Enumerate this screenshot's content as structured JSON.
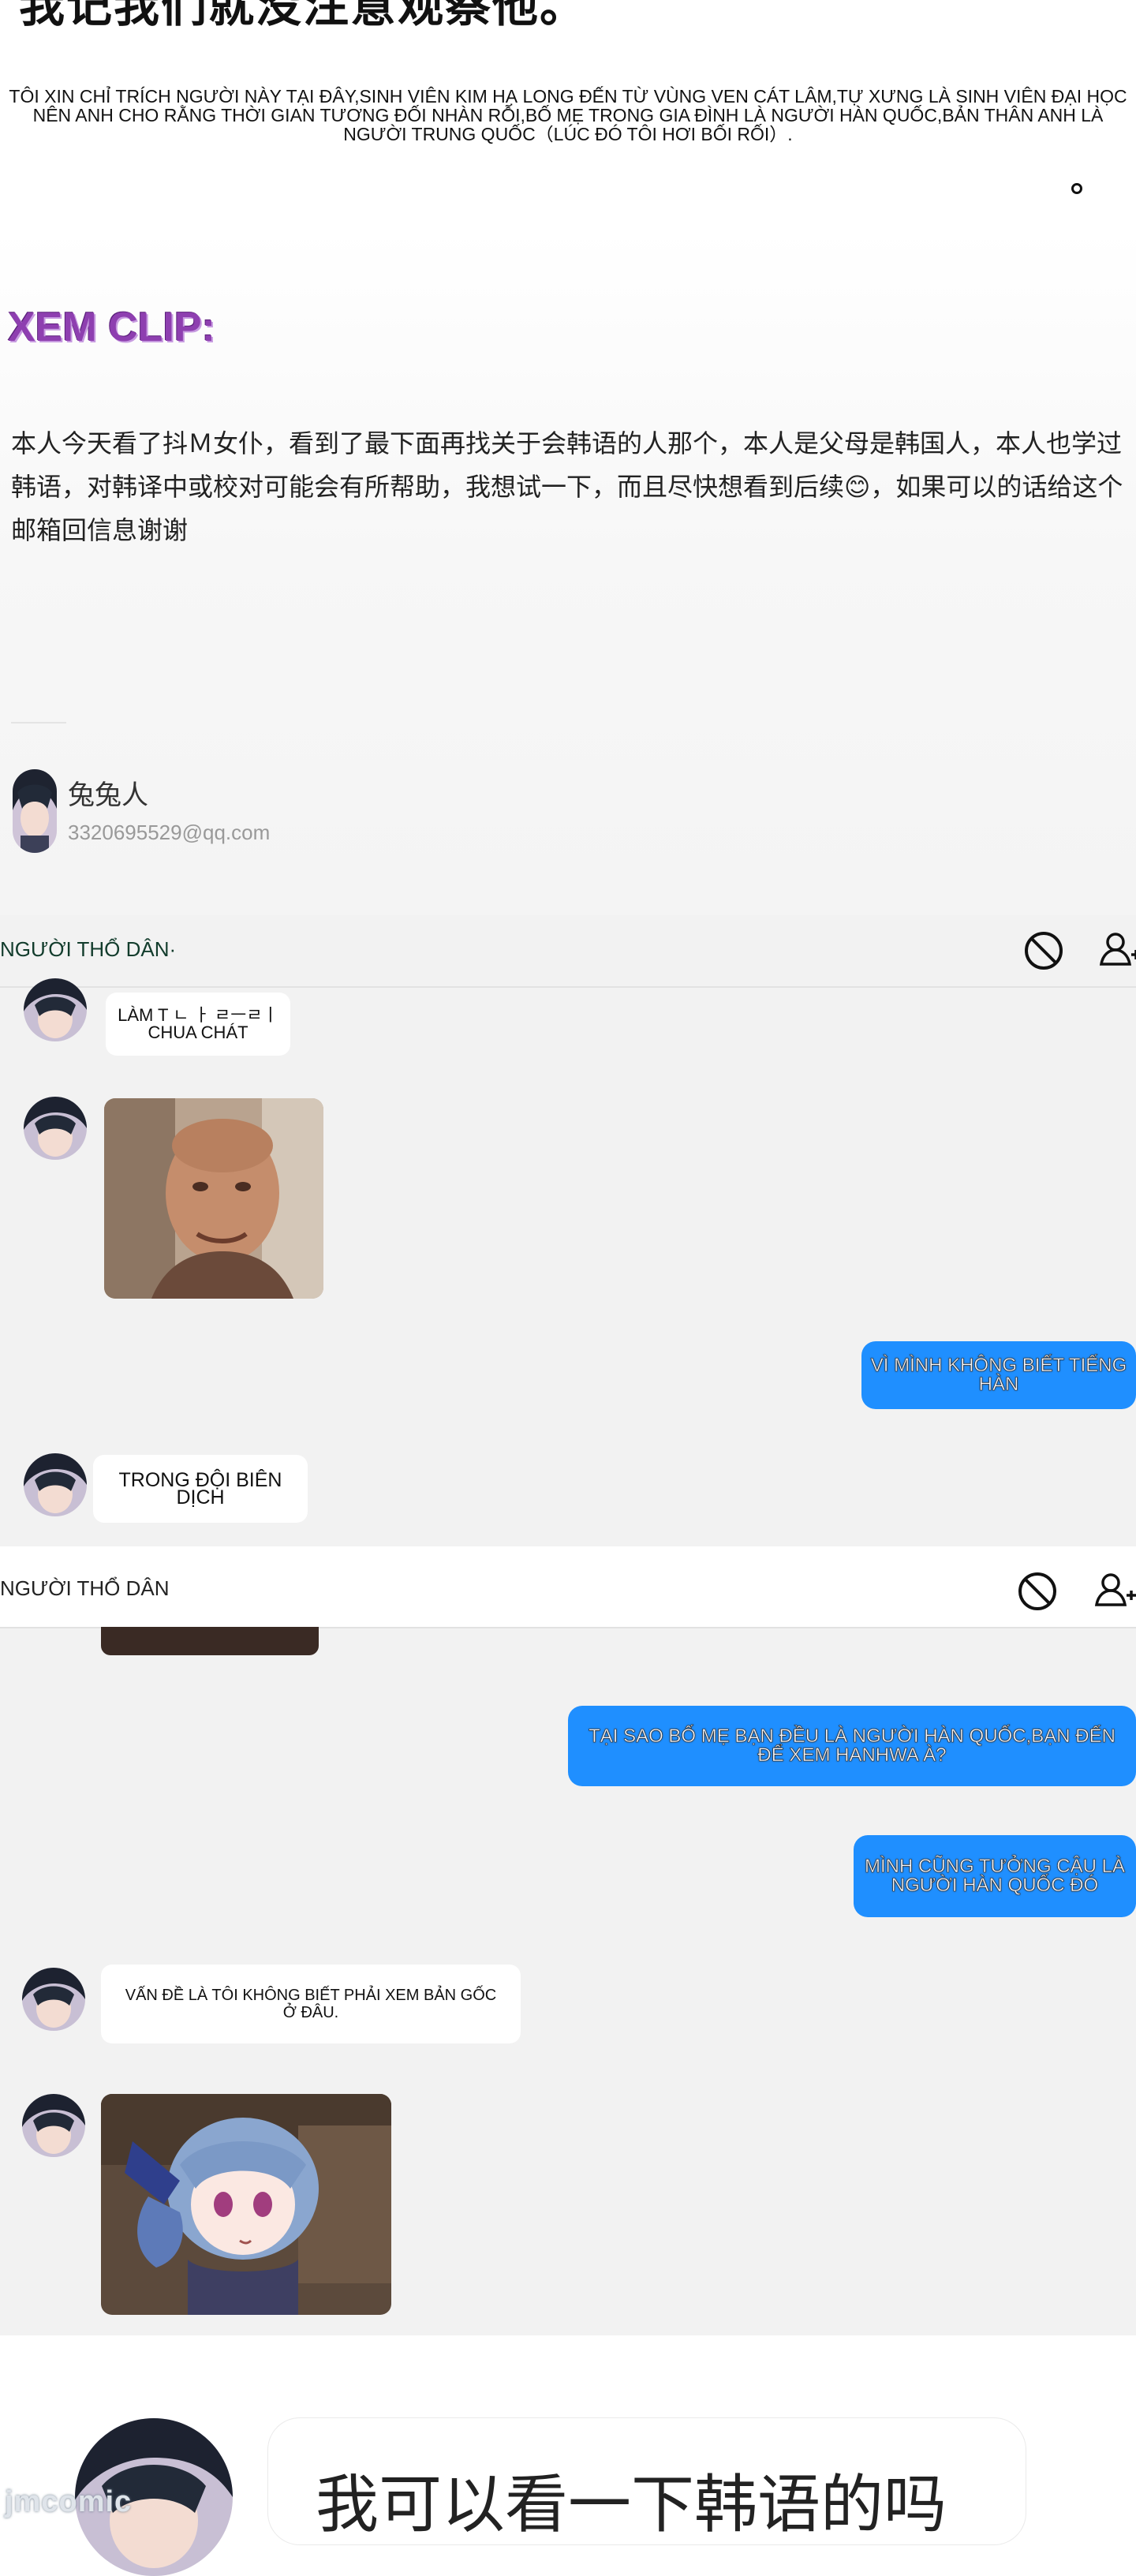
{
  "top": {
    "cn_title": "我记我们就没注意观察他。",
    "vn_note": "TÔI XIN CHỈ TRÍCH NGƯỜI NÀY TẠI ĐÂY,SINH VIÊN KIM HẠ LONG ĐẾN TỪ VÙNG VEN CÁT LÂM,TỰ XƯNG LÀ SINH VIÊN ĐẠI HỌC NÊN ANH CHO RẰNG THỜI GIAN TƯƠNG ĐỐI NHÀN RỖI,BỐ MẸ TRONG GIA ĐÌNH LÀ NGƯỜI HÀN QUỐC,BẢN THÂN ANH LÀ NGƯỜI TRUNG QUỐC（LÚC ĐÓ TÔI HƠI BỐI RỐI）."
  },
  "section_label": "XEM CLIP:",
  "email": {
    "body": "本人今天看了抖Ｍ女仆，看到了最下面再找关于会韩语的人那个，本人是父母是韩国人，本人也学过韩语，对韩译中或校对可能会有所帮助，我想试一下，而且尽快想看到后续😊，如果可以的话给这个邮箱回信息谢谢",
    "sender_name": "兔兔人",
    "sender_email": "3320695529@qq.com"
  },
  "chat1": {
    "title": "NGƯỜI THỔ DÂN·",
    "messages": [
      {
        "side": "left",
        "type": "text",
        "text": "LÀM T ㄴ ㅏ ㄹㅡㄹㅣ CHUA CHÁT"
      },
      {
        "side": "left",
        "type": "image",
        "image": "man-meme-photo"
      },
      {
        "side": "right",
        "type": "text",
        "text": "VÌ MÌNH KHÔNG BIẾT TIẾNG HÀN"
      },
      {
        "side": "left",
        "type": "text",
        "text": "TRONG ĐỘI BIÊN DỊCH"
      }
    ]
  },
  "chat2": {
    "title": "NGƯỜI THỔ DÂN",
    "messages": [
      {
        "side": "right",
        "type": "text",
        "text": "TẠI SAO BỐ MẸ BẠN ĐỀU LÀ NGƯỜI HÀN QUỐC,BẠN ĐẾN ĐỂ XEM HANHWA À?"
      },
      {
        "side": "right",
        "type": "text",
        "text": "MÌNH CŨNG TƯỞNG CẬU LÀ NGƯỜI HÀN QUỐC ĐÓ"
      },
      {
        "side": "left",
        "type": "text",
        "text": "VẤN ĐỀ LÀ TÔI KHÔNG BIẾT PHẢI XEM BẢN GỐC Ở ĐÂU."
      },
      {
        "side": "left",
        "type": "image",
        "image": "anime-girl-sticker"
      }
    ]
  },
  "bottom_bubble": "我可以看一下韩语的吗",
  "watermark": "jmcomic",
  "colors": {
    "accent_blue": "#1f8fff",
    "chat_bg": "#f2f2f2",
    "xem_purple": "#8e3fb0"
  }
}
